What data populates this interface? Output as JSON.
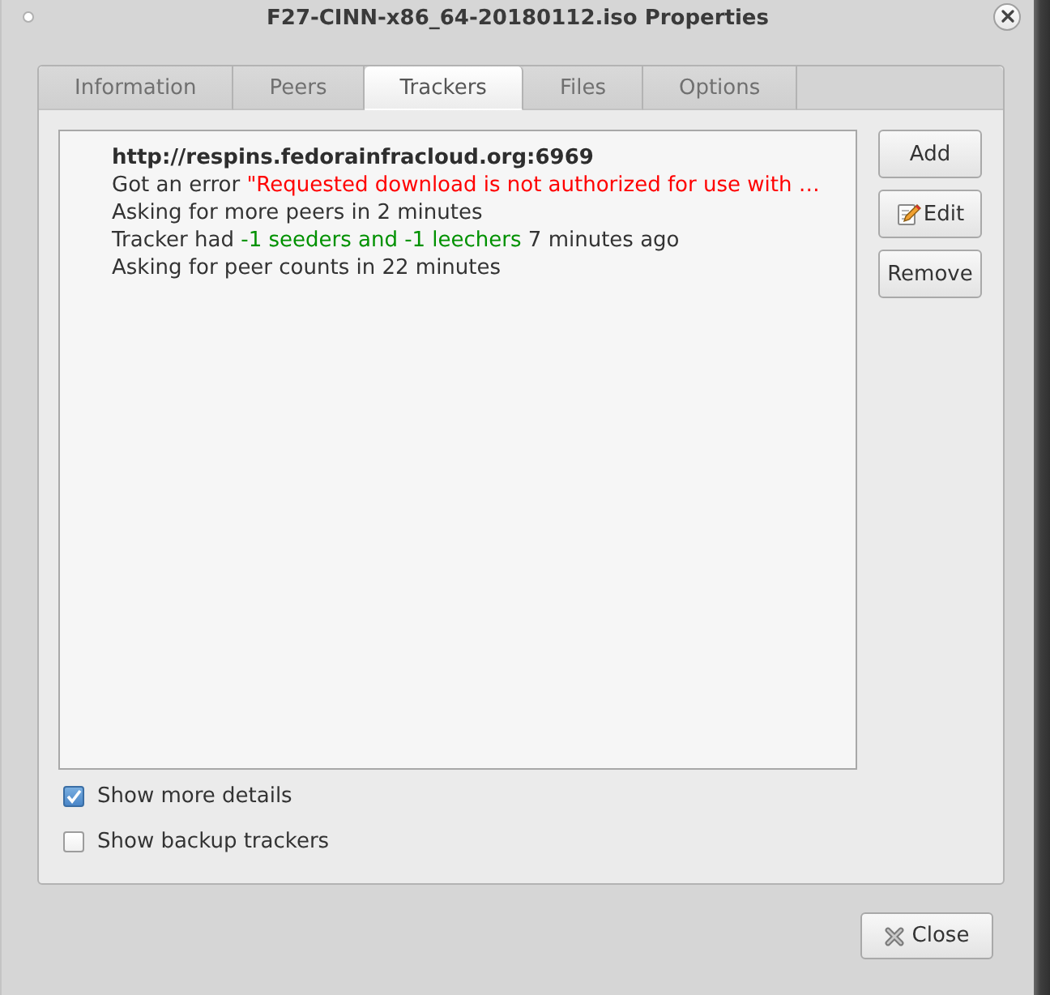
{
  "window": {
    "title": "F27-CINN-x86_64-20180112.iso Properties"
  },
  "tabs": [
    {
      "label": "Information",
      "selected": false
    },
    {
      "label": "Peers",
      "selected": false
    },
    {
      "label": "Trackers",
      "selected": true
    },
    {
      "label": "Files",
      "selected": false
    },
    {
      "label": "Options",
      "selected": false
    }
  ],
  "trackers": [
    {
      "url": "http://respins.fedorainfracloud.org:6969",
      "lines": [
        {
          "parts": [
            {
              "text": "Got an error "
            },
            {
              "text": "\"Requested download is not authorized for use with …",
              "kind": "error"
            }
          ]
        },
        {
          "parts": [
            {
              "text": "Asking for more peers in 2 minutes"
            }
          ]
        },
        {
          "parts": [
            {
              "text": "Tracker had "
            },
            {
              "text": "-1 seeders and -1 leechers",
              "kind": "count"
            },
            {
              "text": " 7 minutes ago"
            }
          ]
        },
        {
          "parts": [
            {
              "text": "Asking for peer counts in 22 minutes"
            }
          ]
        }
      ]
    }
  ],
  "tracker_buttons": [
    {
      "label": "Add",
      "kind": "text"
    },
    {
      "label": "Edit",
      "kind": "icon_text"
    },
    {
      "label": "Remove",
      "kind": "text"
    }
  ],
  "options": [
    {
      "label": "Show more details",
      "checked": true
    },
    {
      "label": "Show backup trackers",
      "checked": false
    }
  ],
  "close_button": {
    "label": "Close"
  }
}
